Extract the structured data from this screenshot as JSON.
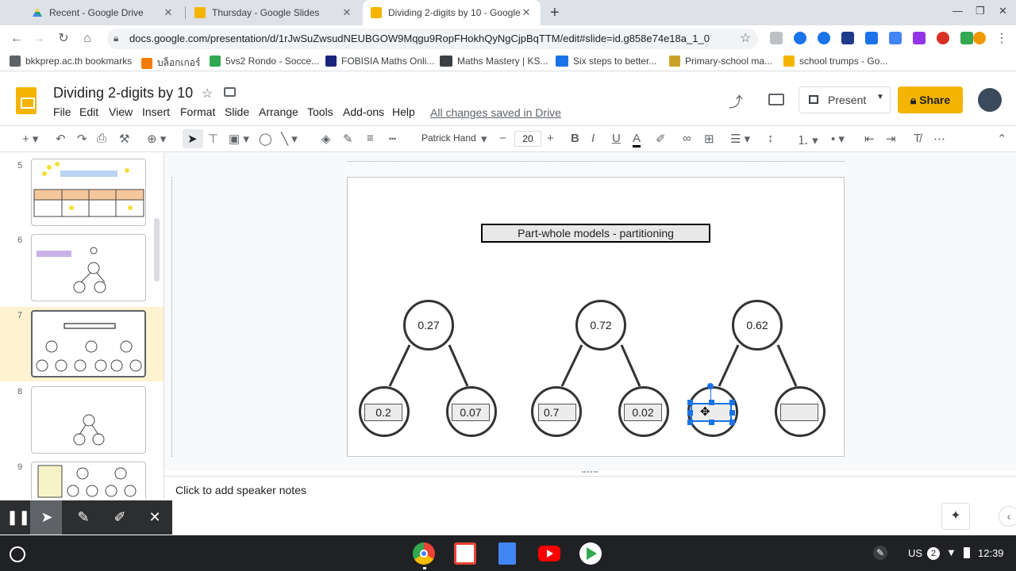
{
  "browser": {
    "tabs": [
      {
        "title": "Recent - Google Drive",
        "active": false
      },
      {
        "title": "Thursday - Google Slides",
        "active": false
      },
      {
        "title": "Dividing 2-digits by 10 - Google S",
        "active": true
      }
    ],
    "url": "docs.google.com/presentation/d/1rJwSuZwsudNEUBGOW9Mqgu9RopFHokhQyNgCjpBqTTM/edit#slide=id.g858e74e18a_1_0",
    "bookmarks": [
      "bkkprep.ac.th bookmarks",
      "บล็อกเกอร์",
      "5vs2 Rondo - Socce...",
      "FOBISIA Maths Onli...",
      "Maths Mastery | KS...",
      "Six steps to better...",
      "Primary-school ma...",
      "school trumps - Go..."
    ]
  },
  "slides_app": {
    "title": "Dividing 2-digits by 10",
    "menu": [
      "File",
      "Edit",
      "View",
      "Insert",
      "Format",
      "Slide",
      "Arrange",
      "Tools",
      "Add-ons",
      "Help"
    ],
    "saved_status": "All changes saved in Drive",
    "present_label": "Present",
    "share_label": "Share",
    "font": "Patrick Hand",
    "font_size": "20",
    "accent": "#f4b400"
  },
  "filmstrip": {
    "slides": [
      "5",
      "6",
      "7",
      "8",
      "9"
    ],
    "active": "7"
  },
  "slide": {
    "title": "Part-whole models - partitioning",
    "models": [
      {
        "whole": "0.27",
        "parts": [
          "0.2",
          "0.07"
        ]
      },
      {
        "whole": "0.72",
        "parts": [
          "0.7",
          "0.02"
        ]
      },
      {
        "whole": "0.62",
        "parts": [
          "",
          ""
        ]
      }
    ]
  },
  "notes": {
    "placeholder": "Click to add speaker notes"
  },
  "shelf": {
    "locale": "US",
    "notifications": "2",
    "time": "12:39"
  }
}
